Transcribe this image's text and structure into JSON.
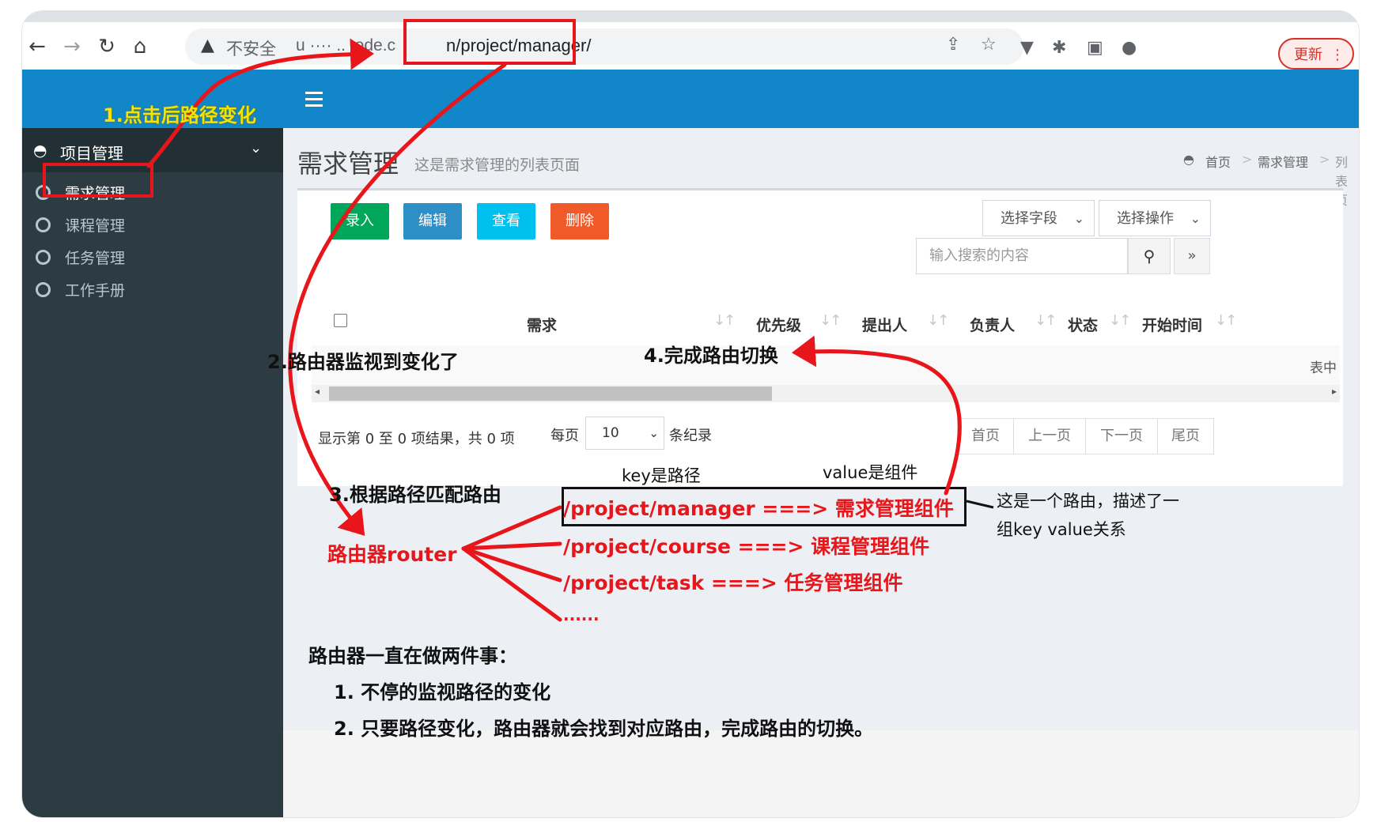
{
  "browser": {
    "security": "不安全",
    "url_host": "u  ···· ..  .ode.c",
    "url_path": "n/project/manager/",
    "update_label": "更新"
  },
  "sidebar": {
    "group_label": "项目管理",
    "items": [
      {
        "label": "需求管理",
        "active": true
      },
      {
        "label": "课程管理",
        "active": false
      },
      {
        "label": "任务管理",
        "active": false
      },
      {
        "label": "工作手册",
        "active": false
      }
    ]
  },
  "page_header": {
    "title": "需求管理",
    "subtitle": "这是需求管理的列表页面",
    "breadcrumb": [
      "首页",
      "需求管理",
      "列表页"
    ]
  },
  "toolbar": {
    "buttons": [
      {
        "label": "录入",
        "color": "#00a65a"
      },
      {
        "label": "编辑",
        "color": "#2e8fc6"
      },
      {
        "label": "查看",
        "color": "#00c0ef"
      },
      {
        "label": "删除",
        "color": "#f05a28"
      }
    ],
    "select_field": "选择字段",
    "select_operation": "选择操作",
    "search_placeholder": "输入搜索的内容"
  },
  "table": {
    "columns": [
      "需求",
      "优先级",
      "提出人",
      "负责人",
      "状态",
      "开始时间"
    ],
    "empty_text": "表中",
    "info": "显示第 0 至 0 项结果，共 0 项",
    "per_page_label": "每页",
    "per_page_value": "10",
    "records_label": "条纪录",
    "pager": [
      "首页",
      "上一页",
      "下一页",
      "尾页"
    ]
  },
  "annotations": {
    "step1": "1.点击后路径变化",
    "step2": "2.路由器监视到变化了",
    "step3": "3.根据路径匹配路由",
    "step4": "4.完成路由切换",
    "key_label": "key是路径",
    "value_label": "value是组件",
    "router_label": "路由器router",
    "routes": [
      "/project/manager ===> 需求管理组件",
      "/project/course ===> 课程管理组件",
      "/project/task ===> 任务管理组件",
      "......"
    ],
    "route_note_line1": "这是一个路由，描述了一",
    "route_note_line2": "组key value关系",
    "summary_title": "路由器一直在做两件事：",
    "summary_items": [
      "1. 不停的监视路径的变化",
      "2. 只要路径变化，路由器就会找到对应路由，完成路由的切换。"
    ]
  },
  "colors": {
    "header_blue": "#1186c8",
    "sidebar_dark": "#2c3c42",
    "annotation_red": "#e8161b",
    "annotation_yellow": "#f5e400"
  }
}
